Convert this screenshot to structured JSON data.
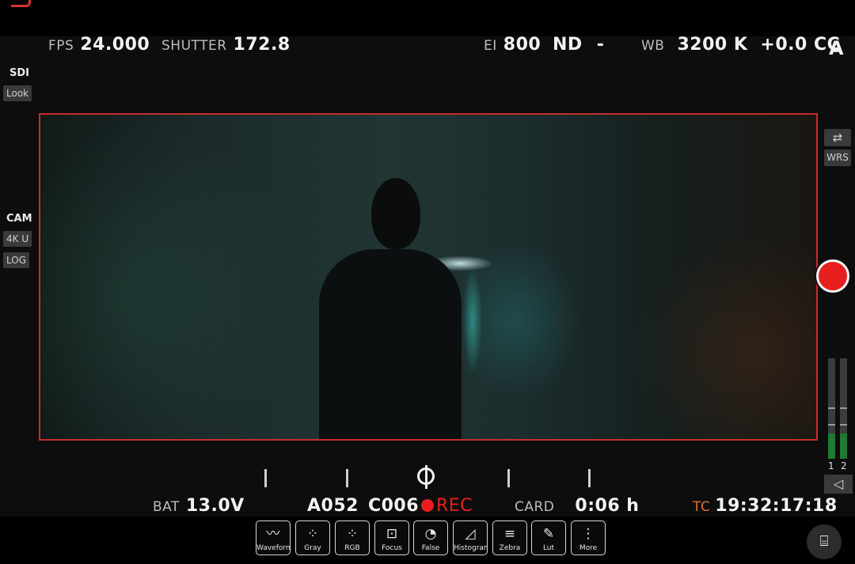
{
  "header": {
    "fps_label": "FPS",
    "fps_value": "24.000",
    "shutter_label": "SHUTTER",
    "shutter_value": "172.8",
    "ei_label": "EI",
    "ei_value": "800",
    "nd_label": "ND",
    "nd_value": "-",
    "wb_label": "WB",
    "wb_value": "3200 K",
    "cc_value": "+0.0 CC",
    "mode_letter": "A"
  },
  "left_panel": {
    "sdi_label": "SDI",
    "look_chip": "Look",
    "cam_label": "CAM",
    "resolution_chip": "4K U",
    "gamma_chip": "LOG"
  },
  "right_panel": {
    "flip_icon": "camera-flip-icon",
    "wrs_label": "WRS",
    "audio_channels": [
      "1",
      "2"
    ],
    "audio_levels": [
      0.25,
      0.25
    ],
    "speaker_icon": "speaker-icon"
  },
  "status": {
    "bat_label": "BAT",
    "bat_value": "13.0V",
    "reel": "A052",
    "clip": "C006",
    "rec_label": "REC",
    "card_label": "CARD",
    "card_value": "0:06 h",
    "tc_label": "TC",
    "tc_value": "19:32:17:18"
  },
  "toolbar": [
    {
      "label": "Waveform",
      "icon": "waveform-icon",
      "glyph": "〰"
    },
    {
      "label": "Gray",
      "icon": "gray-dots-icon",
      "glyph": "⁘"
    },
    {
      "label": "RGB",
      "icon": "rgb-dots-icon",
      "glyph": "⁘"
    },
    {
      "label": "Focus",
      "icon": "focus-icon",
      "glyph": "⊡"
    },
    {
      "label": "False",
      "icon": "false-color-palette-icon",
      "glyph": "◔"
    },
    {
      "label": "Histogram",
      "icon": "histogram-icon",
      "glyph": "◿"
    },
    {
      "label": "Zebra",
      "icon": "zebra-lines-icon",
      "glyph": "≡"
    },
    {
      "label": "Lut",
      "icon": "lut-wand-icon",
      "glyph": "✎"
    },
    {
      "label": "More",
      "icon": "more-vertical-icon",
      "glyph": "⋮"
    }
  ],
  "colors": {
    "frame_border": "#c52d2d",
    "record": "#e81e1e",
    "tc_accent": "#e0702a",
    "meter_green": "#1f7a2f"
  }
}
